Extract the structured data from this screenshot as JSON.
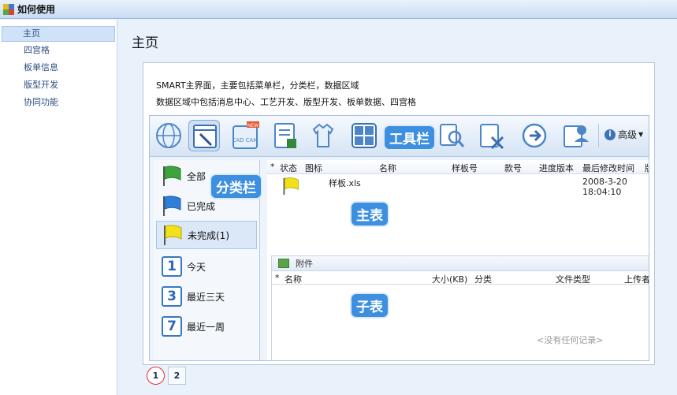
{
  "window": {
    "title": "如何使用"
  },
  "sidebar": {
    "items": [
      {
        "label": "主页",
        "active": true
      },
      {
        "label": "四宫格",
        "active": false
      },
      {
        "label": "板单信息",
        "active": false
      },
      {
        "label": "版型开发",
        "active": false
      },
      {
        "label": "协同功能",
        "active": false
      }
    ]
  },
  "main": {
    "title": "主页",
    "desc_line1": "SMART主界面，主要包括菜单栏，分类栏，数据区域",
    "desc_line2": "数据区域中包括消息中心、工艺开发、版型开发、板单数据、四宫格"
  },
  "toolbar": {
    "advanced_label": "高级",
    "new_badge": "NEW",
    "cadcam_label": "CAD CAM"
  },
  "callouts": {
    "toolbar": "工具栏",
    "category": "分类栏",
    "main_table": "主表",
    "sub_table": "子表"
  },
  "categories": [
    {
      "label": "全部",
      "icon": "green-flag-icon"
    },
    {
      "label": "已完成",
      "icon": "blue-flag-icon"
    },
    {
      "label": "未完成(1)",
      "icon": "yellow-flag-icon"
    },
    {
      "label": "今天",
      "icon": "calendar-1-icon",
      "num": "1"
    },
    {
      "label": "最近三天",
      "icon": "calendar-3-icon",
      "num": "3"
    },
    {
      "label": "最近一周",
      "icon": "calendar-7-icon",
      "num": "7"
    }
  ],
  "main_table": {
    "columns": [
      "*",
      "状态",
      "图标",
      "名称",
      "样板号",
      "款号",
      "进度版本",
      "最后修改时间",
      "版"
    ],
    "row": {
      "name": "样板.xls",
      "date": "2008-3-20",
      "time": "18:04:10"
    }
  },
  "sub_table": {
    "title": "附件",
    "columns": [
      "*",
      "名称",
      "大小(KB)",
      "分类",
      "文件类型",
      "上传者"
    ],
    "empty_text": "<没有任何记录>"
  },
  "pager": {
    "pages": [
      "1",
      "2"
    ],
    "current": "1"
  },
  "colors": {
    "accent": "#3d8fdf",
    "sidebar_active": "#cfe2f7",
    "background": "#e9f1fb"
  }
}
